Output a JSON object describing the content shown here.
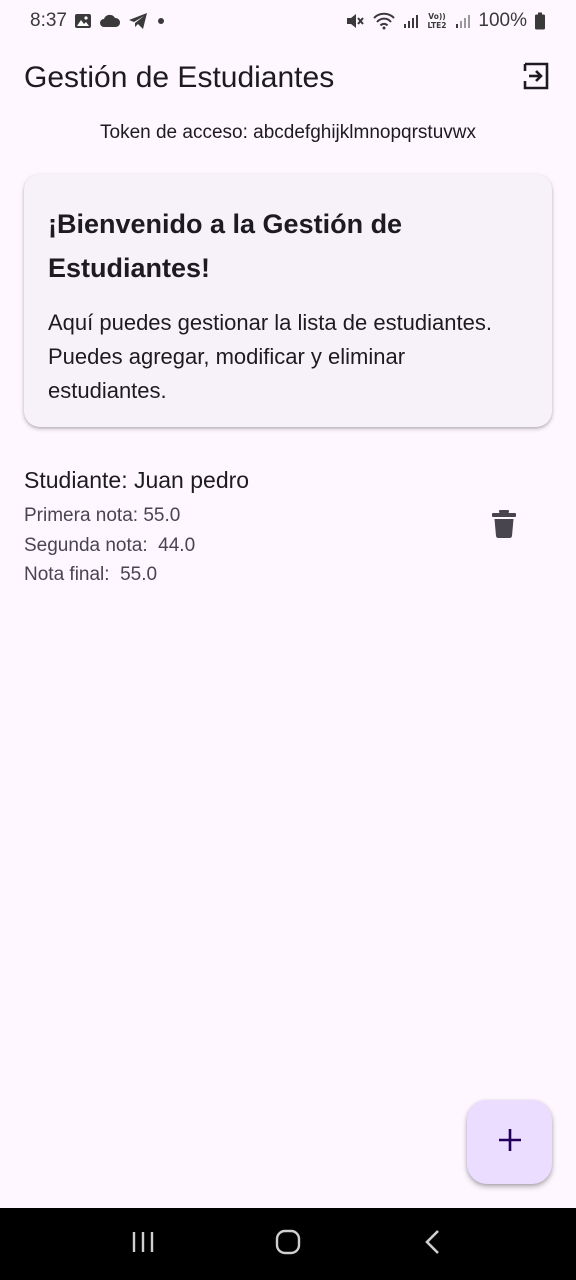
{
  "status_bar": {
    "time": "8:37",
    "left_icons": [
      "image-icon",
      "cloud-icon",
      "telegram-icon",
      "dot-icon"
    ],
    "right_icons": [
      "mute-icon",
      "wifi-icon",
      "signal-icon",
      "volte-icon",
      "signal2-icon",
      "battery-icon"
    ],
    "battery": "100%"
  },
  "app_bar": {
    "title": "Gestión de Estudiantes",
    "logout_icon": "logout-icon"
  },
  "token": {
    "text": "Token de acceso: abcdefghijklmnopqrstuvwx"
  },
  "welcome_card": {
    "title": "¡Bienvenido a la Gestión de Estudiantes!",
    "body": "Aquí puedes gestionar la lista de estudiantes. Puedes agregar, modificar y eliminar estudiantes."
  },
  "students": [
    {
      "name_line": "Studiante: Juan pedro",
      "grade1_line": "Primera nota: 55.0",
      "grade2_line": "Segunda nota:  44.0",
      "final_line": "Nota final:  55.0",
      "delete_icon": "trash-icon"
    }
  ],
  "fab": {
    "icon": "plus-icon"
  },
  "nav_bar": {
    "icons": [
      "recent-apps-icon",
      "home-icon",
      "back-icon"
    ]
  },
  "colors": {
    "background": "#fef7ff",
    "card": "#f7f2fa",
    "fab": "#eaddff",
    "text": "#1d1b20",
    "secondary_text": "#49454f"
  }
}
